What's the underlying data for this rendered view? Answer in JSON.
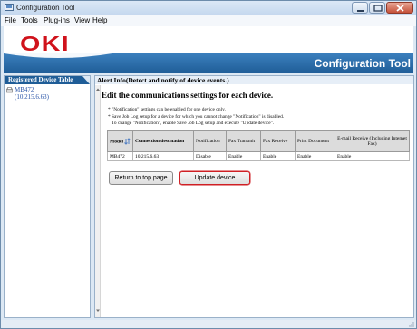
{
  "window": {
    "title": "Configuration Tool"
  },
  "menu": {
    "items": [
      "File",
      "Tools",
      "Plug-ins",
      "View",
      "Help"
    ]
  },
  "header": {
    "logo_text": "OKI",
    "banner_title": "Configuration Tool",
    "brand_color": "#d0121b",
    "accent_color": "#1f5d97"
  },
  "sidebar": {
    "title": "Registered Device Table",
    "device": {
      "name": "MB472",
      "ip": "(10.215.6.63)"
    }
  },
  "main": {
    "header_text": "Alert Info(Detect and notify of device events.)",
    "content_title": "Edit the communications settings for each device.",
    "notes": [
      "* \"Notification\" settings can be enabled for one device only.",
      "* Save Job Log setup for a device for which you cannot change \"Notification\" is disabled.",
      "To change \"Notification\", enable Save Job Log setup and execute \"Update device\"."
    ],
    "table": {
      "headers": [
        "Model",
        "Connection destination",
        "Notification",
        "Fax Transmit",
        "Fax Receive",
        "Print Document",
        "E-mail Receive (Including Internet Fax)"
      ],
      "rows": [
        [
          "MB472",
          "10.215.6.63",
          "Disable",
          "Enable",
          "Enable",
          "Enable",
          "Enable"
        ]
      ]
    },
    "buttons": {
      "return_label": "Return to top page",
      "update_label": "Update device"
    }
  }
}
